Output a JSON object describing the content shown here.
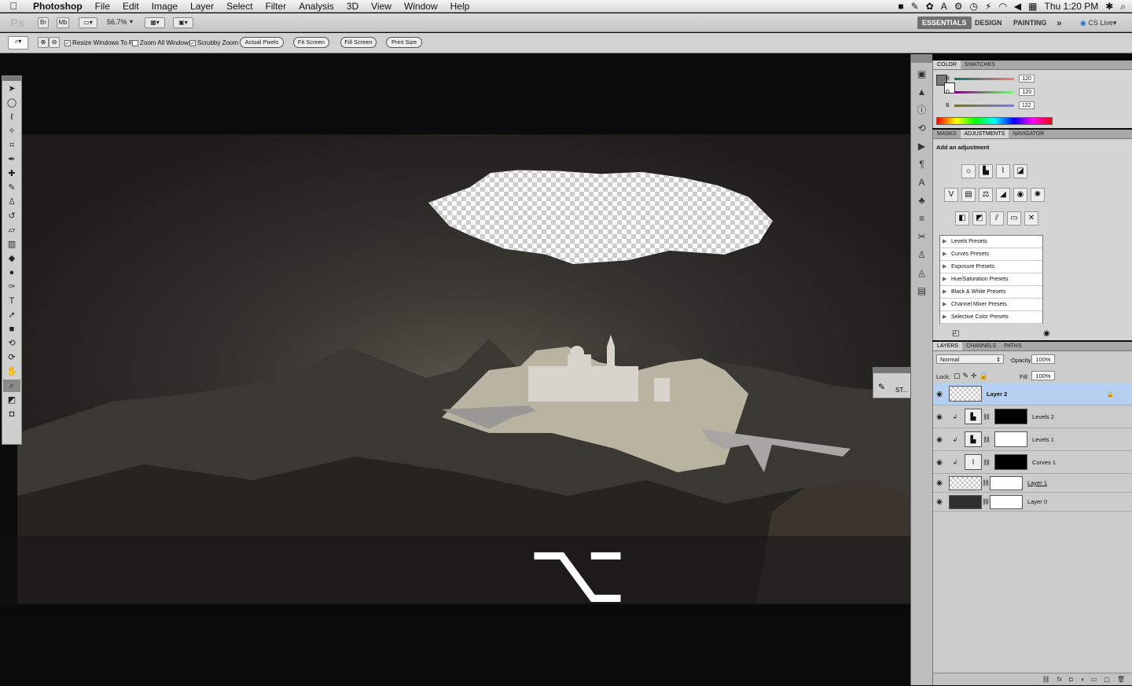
{
  "menubar": {
    "app": "Photoshop",
    "items": [
      "File",
      "Edit",
      "Image",
      "Layer",
      "Select",
      "Filter",
      "Analysis",
      "3D",
      "View",
      "Window",
      "Help"
    ],
    "clock": "Thu 1:20 PM"
  },
  "appbar": {
    "logo": "Ps",
    "br": "Br",
    "mb": "Mb",
    "zoom": "56.7%",
    "workspaces": [
      "ESSENTIALS",
      "DESIGN",
      "PAINTING"
    ],
    "more": "»",
    "cslive": "CS Live"
  },
  "options": {
    "resize_windows": "Resize Windows To Fit",
    "zoom_all": "Zoom All Windows",
    "scrubby": "Scrubby Zoom",
    "actual_pixels": "Actual Pixels",
    "fit_screen": "Fit Screen",
    "fill_screen": "Fill Screen",
    "print_size": "Print Size"
  },
  "canvas": {
    "key_glyph": "⌥"
  },
  "float_panel": {
    "label": "ST..."
  },
  "color_panel": {
    "tabs": [
      "COLOR",
      "SWATCHES"
    ],
    "r_label": "R",
    "g_label": "G",
    "b_label": "B",
    "r": "120",
    "g": "120",
    "b": "122"
  },
  "adjustments_panel": {
    "tabs": [
      "MASKS",
      "ADJUSTMENTS",
      "NAVIGATOR"
    ],
    "heading": "Add an adjustment",
    "presets": [
      "Levels Presets",
      "Curves Presets",
      "Exposure Presets",
      "Hue/Saturation Presets",
      "Black & White Presets",
      "Channel Mixer Presets",
      "Selective Color Presets"
    ]
  },
  "layers_panel": {
    "tabs": [
      "LAYERS",
      "CHANNELS",
      "PATHS"
    ],
    "blend_mode": "Normal",
    "opacity_label": "Opacity:",
    "opacity": "100%",
    "lock_label": "Lock:",
    "fill_label": "Fill:",
    "fill": "100%",
    "layers": [
      {
        "name": "Layer 2"
      },
      {
        "name": "Levels 2"
      },
      {
        "name": "Levels 1"
      },
      {
        "name": "Curves 1"
      },
      {
        "name": "Layer 1"
      },
      {
        "name": "Layer 0"
      }
    ]
  }
}
